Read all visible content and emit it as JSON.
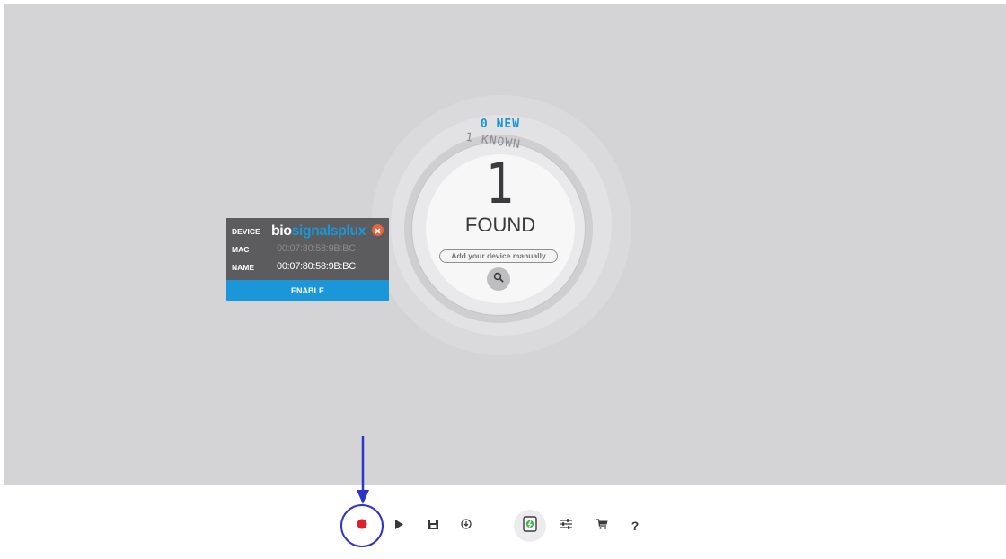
{
  "discovery": {
    "new_label": "0 NEW",
    "known_label": "1 KNOWN",
    "found_count": "1",
    "found_label": "FOUND",
    "manual_add_placeholder": "Add your device manually"
  },
  "device_card": {
    "device_key": "DEVICE",
    "brand_part1": "bio",
    "brand_part2": "signalsplux",
    "mac_key": "MAC",
    "mac_value": "00:07:80:58:9B:BC",
    "name_key": "NAME",
    "name_value": "00:07:80:58:9B:BC",
    "enable_label": "ENABLE",
    "mac_value_color": "#8a8a8c",
    "name_value_color": "#ffffff"
  },
  "toolbar": {
    "left_icons": [
      "record-icon",
      "play-icon",
      "save-icon",
      "download-icon"
    ],
    "right_icons": [
      "device-manager-icon",
      "settings-sliders-icon",
      "cart-icon",
      "help-icon"
    ],
    "help_label": "?"
  },
  "colors": {
    "accent": "#1b96d8",
    "record": "#e01f2c",
    "close": "#e8643c",
    "annotation": "#2b35c9",
    "device_icon_green": "#3fb84a"
  }
}
